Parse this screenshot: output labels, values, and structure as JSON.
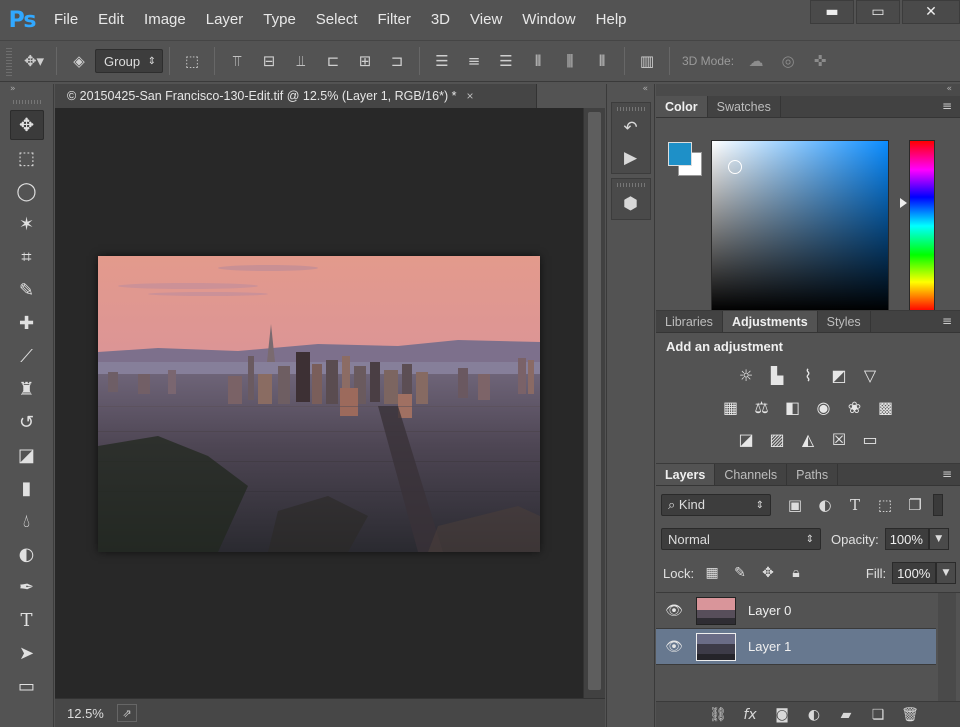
{
  "app": {
    "logo": "Ps",
    "menu": [
      "File",
      "Edit",
      "Image",
      "Layer",
      "Type",
      "Select",
      "Filter",
      "3D",
      "View",
      "Window",
      "Help"
    ],
    "window_controls": [
      "▬",
      "▭",
      "✕"
    ]
  },
  "options_bar": {
    "auto_select_value": "Group",
    "mode_label": "3D Mode:"
  },
  "document": {
    "tab_title": "© 20150425-San Francisco-130-Edit.tif @ 12.5% (Layer 1, RGB/16*) *",
    "tab_close": "×",
    "zoom": "12.5%"
  },
  "color_panel": {
    "tabs": [
      "Color",
      "Swatches"
    ],
    "active_tab": "Color",
    "foreground": "#1e90c8",
    "background": "#ffffff"
  },
  "adjustments_panel": {
    "tabs": [
      "Libraries",
      "Adjustments",
      "Styles"
    ],
    "active_tab": "Adjustments",
    "title": "Add an adjustment"
  },
  "layers_panel": {
    "tabs": [
      "Layers",
      "Channels",
      "Paths"
    ],
    "active_tab": "Layers",
    "filter_kind": "Kind",
    "blend_mode": "Normal",
    "opacity_label": "Opacity:",
    "opacity": "100%",
    "lock_label": "Lock:",
    "fill_label": "Fill:",
    "fill": "100%",
    "layers": [
      {
        "name": "Layer 0",
        "selected": false
      },
      {
        "name": "Layer 1",
        "selected": true
      }
    ]
  }
}
